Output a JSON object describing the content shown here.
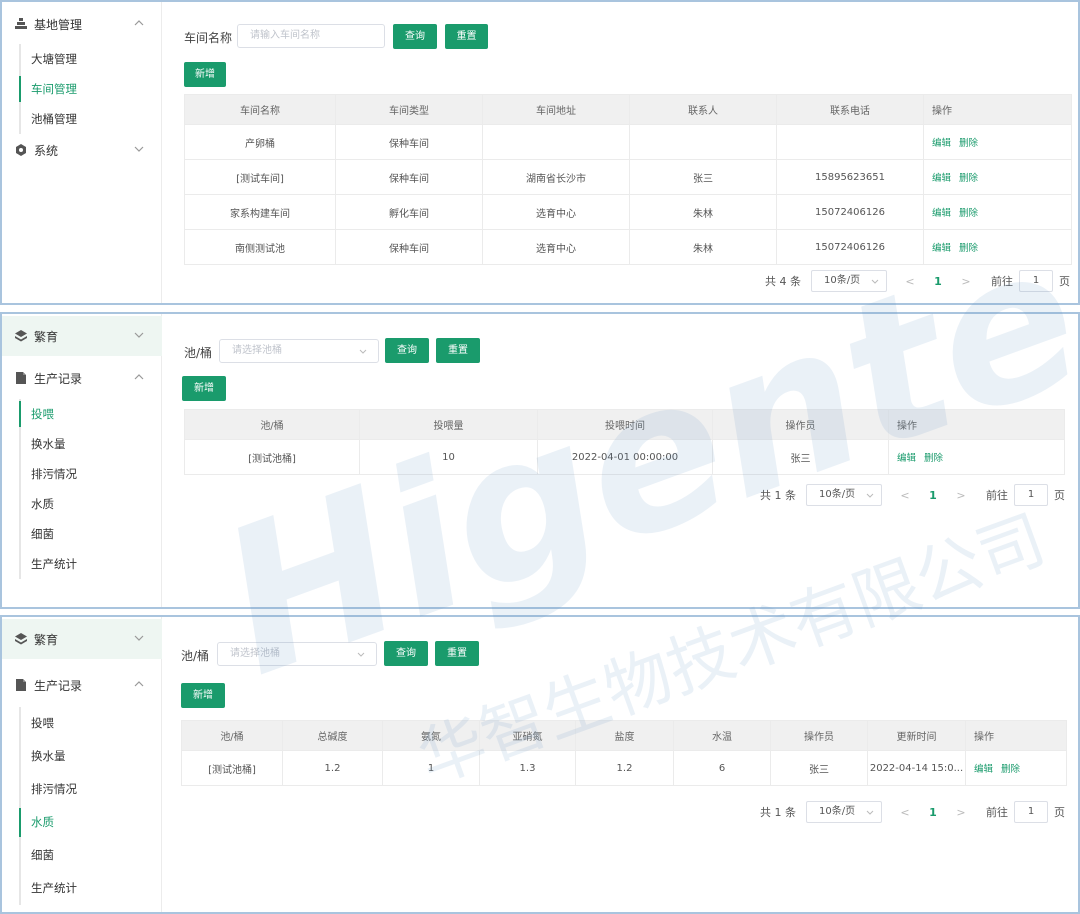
{
  "panel1": {
    "sidebar": {
      "group_base": "基地管理",
      "items": [
        "大塘管理",
        "车间管理",
        "池桶管理"
      ],
      "group_system": "系统"
    },
    "filter_label": "车间名称",
    "filter_placeholder": "请输入车间名称",
    "query_label": "查询",
    "reset_label": "重置",
    "add_label": "新增",
    "columns": [
      "车间名称",
      "车间类型",
      "车间地址",
      "联系人",
      "联系电话",
      "操作"
    ],
    "rows": [
      [
        "产卵桶",
        "保种车间",
        "",
        "",
        ""
      ],
      [
        "[测试车间]",
        "保种车间",
        "湖南省长沙市",
        "张三",
        "15895623651"
      ],
      [
        "家系构建车间",
        "孵化车间",
        "选育中心",
        "朱林",
        "15072406126"
      ],
      [
        "南侧测试池",
        "保种车间",
        "选育中心",
        "朱林",
        "15072406126"
      ]
    ],
    "edit_label": "编辑",
    "delete_label": "删除",
    "pager": {
      "total": "共 4 条",
      "page_size": "10条/页",
      "prev": "<",
      "page": "1",
      "next": ">",
      "goto": "前往",
      "goto_value": "1",
      "unit": "页"
    }
  },
  "panel2": {
    "sidebar": {
      "group_breed": "繁育",
      "group_records": "生产记录",
      "items": [
        "投喂",
        "换水量",
        "排污情况",
        "水质",
        "细菌",
        "生产统计"
      ]
    },
    "filter_label": "池/桶",
    "filter_placeholder": "请选择池桶",
    "query_label": "查询",
    "reset_label": "重置",
    "add_label": "新增",
    "columns": [
      "池/桶",
      "投喂量",
      "投喂时间",
      "操作员",
      "操作"
    ],
    "rows": [
      [
        "[测试池桶]",
        "10",
        "2022-04-01 00:00:00",
        "张三"
      ]
    ],
    "edit_label": "编辑",
    "delete_label": "删除",
    "pager": {
      "total": "共 1 条",
      "page_size": "10条/页",
      "prev": "<",
      "page": "1",
      "next": ">",
      "goto": "前往",
      "goto_value": "1",
      "unit": "页"
    }
  },
  "panel3": {
    "sidebar": {
      "group_breed": "繁育",
      "group_records": "生产记录",
      "items": [
        "投喂",
        "换水量",
        "排污情况",
        "水质",
        "细菌",
        "生产统计"
      ]
    },
    "filter_label": "池/桶",
    "filter_placeholder": "请选择池桶",
    "query_label": "查询",
    "reset_label": "重置",
    "add_label": "新增",
    "columns": [
      "池/桶",
      "总碱度",
      "氨氮",
      "亚硝氮",
      "盐度",
      "水温",
      "操作员",
      "更新时间",
      "操作"
    ],
    "rows": [
      [
        "[测试池桶]",
        "1.2",
        "1",
        "1.3",
        "1.2",
        "6",
        "张三",
        "2022-04-14 15:0..."
      ]
    ],
    "edit_label": "编辑",
    "delete_label": "删除",
    "pager": {
      "total": "共 1 条",
      "page_size": "10条/页",
      "prev": "<",
      "page": "1",
      "next": ">",
      "goto": "前往",
      "goto_value": "1",
      "unit": "页"
    }
  },
  "watermark": {
    "brand": "Higentec",
    "company": "华智生物技术有限公司"
  },
  "colors": {
    "accent": "#1a9b6c",
    "header_bg": "#f0f0f0",
    "panel_border": "#a9c4de",
    "sidebar_shade": "#eef6f2"
  }
}
